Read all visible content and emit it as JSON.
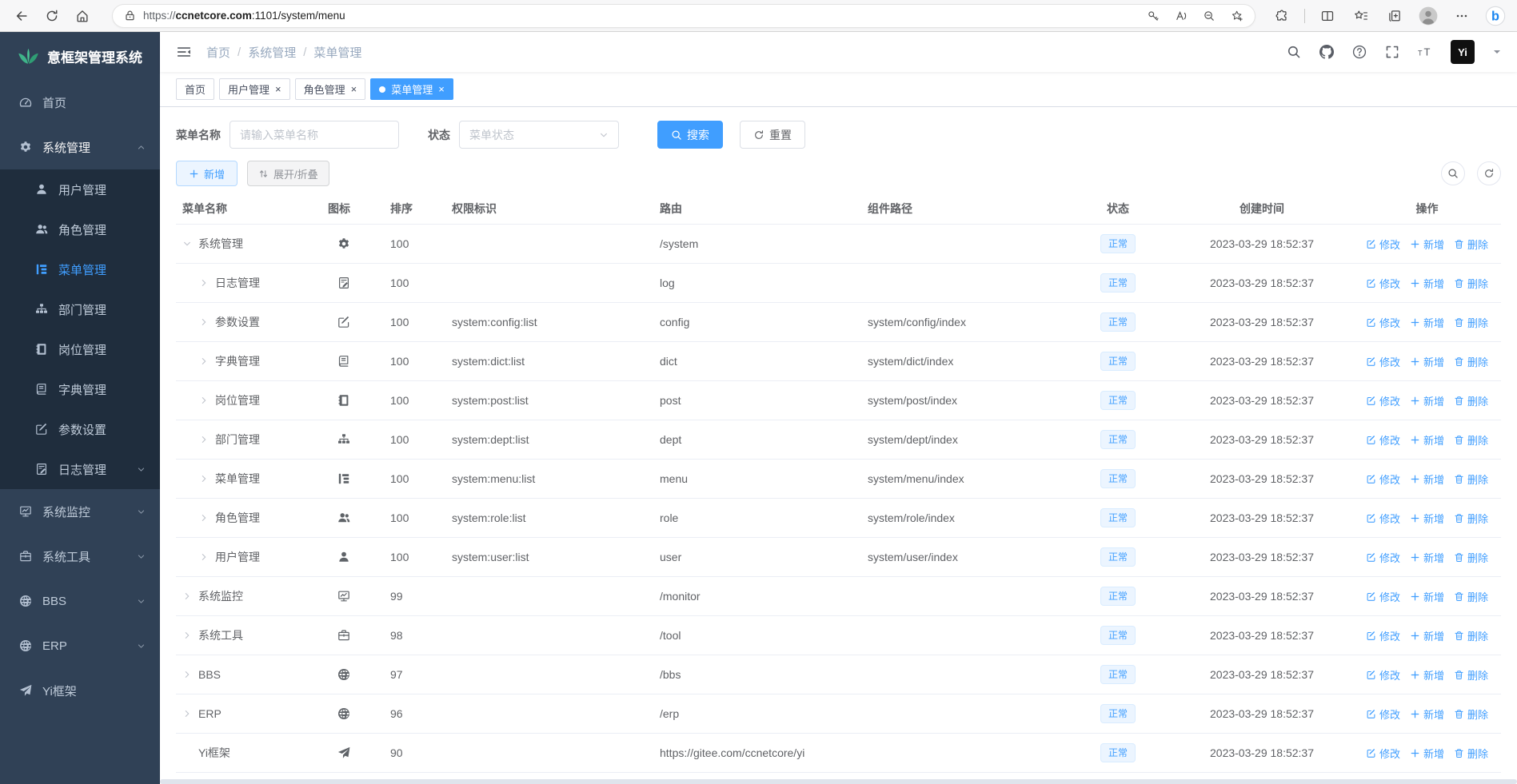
{
  "colors": {
    "accent": "#409eff",
    "sidebar_bg": "#304156",
    "submenu_bg": "#1f2d3d",
    "sidebar_text": "#bfcbd9",
    "logo_green": "#3eb489",
    "badge_bg": "#ecf5ff",
    "badge_text": "#409eff",
    "tab_active_bg": "#409eff"
  },
  "browser": {
    "url_scheme": "https://",
    "url_domain": "ccnetcore.com",
    "url_rest": ":1101/system/menu"
  },
  "sidebar": {
    "logo_text": "意框架管理系统",
    "items": [
      {
        "id": "home",
        "label": "首页",
        "icon": "dashboard-icon",
        "level": "top"
      },
      {
        "id": "system",
        "label": "系统管理",
        "icon": "gear-icon",
        "level": "top",
        "chevron": "up",
        "open": true
      },
      {
        "id": "user",
        "label": "用户管理",
        "icon": "user-icon",
        "level": "sub"
      },
      {
        "id": "role",
        "label": "角色管理",
        "icon": "users-icon",
        "level": "sub"
      },
      {
        "id": "menu",
        "label": "菜单管理",
        "icon": "menu-tree-icon",
        "level": "sub",
        "active": true
      },
      {
        "id": "dept",
        "label": "部门管理",
        "icon": "org-tree-icon",
        "level": "sub"
      },
      {
        "id": "post",
        "label": "岗位管理",
        "icon": "badge-icon",
        "level": "sub"
      },
      {
        "id": "dict",
        "label": "字典管理",
        "icon": "dict-icon",
        "level": "sub"
      },
      {
        "id": "config",
        "label": "参数设置",
        "icon": "edit-icon",
        "level": "sub"
      },
      {
        "id": "log",
        "label": "日志管理",
        "icon": "log-icon",
        "level": "sub",
        "chevron": "down"
      },
      {
        "id": "monitor",
        "label": "系统监控",
        "icon": "monitor-icon",
        "level": "top",
        "chevron": "down"
      },
      {
        "id": "tool",
        "label": "系统工具",
        "icon": "toolbox-icon",
        "level": "top",
        "chevron": "down"
      },
      {
        "id": "bbs",
        "label": "BBS",
        "icon": "globe-icon",
        "level": "top",
        "chevron": "down"
      },
      {
        "id": "erp",
        "label": "ERP",
        "icon": "globe-icon",
        "level": "top",
        "chevron": "down"
      },
      {
        "id": "yi",
        "label": "Yi框架",
        "icon": "send-icon",
        "level": "top"
      }
    ]
  },
  "navbar": {
    "breadcrumb": [
      "首页",
      "系统管理",
      "菜单管理"
    ],
    "avatar_text": "Yi"
  },
  "tabs": [
    {
      "label": "首页"
    },
    {
      "label": "用户管理",
      "closable": true
    },
    {
      "label": "角色管理",
      "closable": true
    },
    {
      "label": "菜单管理",
      "closable": true,
      "active": true
    }
  ],
  "filters": {
    "name_label": "菜单名称",
    "name_placeholder": "请输入菜单名称",
    "status_label": "状态",
    "status_placeholder": "菜单状态",
    "search_label": "搜索",
    "reset_label": "重置"
  },
  "toolbar": {
    "add_label": "新增",
    "expand_label": "展开/折叠"
  },
  "table": {
    "headers": [
      "菜单名称",
      "图标",
      "排序",
      "权限标识",
      "路由",
      "组件路径",
      "状态",
      "创建时间",
      "操作"
    ],
    "actions": {
      "edit": "修改",
      "add": "新增",
      "delete": "删除"
    },
    "rows": [
      {
        "name": "系统管理",
        "level": 0,
        "expand": "expanded",
        "icon": "gear-icon",
        "sort": "100",
        "perms": "",
        "route": "/system",
        "component": "",
        "status": "正常",
        "created": "2023-03-29 18:52:37"
      },
      {
        "name": "日志管理",
        "level": 1,
        "expand": "collapsed",
        "icon": "log-icon",
        "sort": "100",
        "perms": "",
        "route": "log",
        "component": "",
        "status": "正常",
        "created": "2023-03-29 18:52:37"
      },
      {
        "name": "参数设置",
        "level": 1,
        "expand": "collapsed",
        "icon": "edit-icon",
        "sort": "100",
        "perms": "system:config:list",
        "route": "config",
        "component": "system/config/index",
        "status": "正常",
        "created": "2023-03-29 18:52:37"
      },
      {
        "name": "字典管理",
        "level": 1,
        "expand": "collapsed",
        "icon": "dict-icon",
        "sort": "100",
        "perms": "system:dict:list",
        "route": "dict",
        "component": "system/dict/index",
        "status": "正常",
        "created": "2023-03-29 18:52:37"
      },
      {
        "name": "岗位管理",
        "level": 1,
        "expand": "collapsed",
        "icon": "badge-icon",
        "sort": "100",
        "perms": "system:post:list",
        "route": "post",
        "component": "system/post/index",
        "status": "正常",
        "created": "2023-03-29 18:52:37"
      },
      {
        "name": "部门管理",
        "level": 1,
        "expand": "collapsed",
        "icon": "org-tree-icon",
        "sort": "100",
        "perms": "system:dept:list",
        "route": "dept",
        "component": "system/dept/index",
        "status": "正常",
        "created": "2023-03-29 18:52:37"
      },
      {
        "name": "菜单管理",
        "level": 1,
        "expand": "collapsed",
        "icon": "menu-tree-icon",
        "sort": "100",
        "perms": "system:menu:list",
        "route": "menu",
        "component": "system/menu/index",
        "status": "正常",
        "created": "2023-03-29 18:52:37"
      },
      {
        "name": "角色管理",
        "level": 1,
        "expand": "collapsed",
        "icon": "users-icon",
        "sort": "100",
        "perms": "system:role:list",
        "route": "role",
        "component": "system/role/index",
        "status": "正常",
        "created": "2023-03-29 18:52:37"
      },
      {
        "name": "用户管理",
        "level": 1,
        "expand": "collapsed",
        "icon": "user-icon",
        "sort": "100",
        "perms": "system:user:list",
        "route": "user",
        "component": "system/user/index",
        "status": "正常",
        "created": "2023-03-29 18:52:37"
      },
      {
        "name": "系统监控",
        "level": 0,
        "expand": "collapsed",
        "icon": "monitor-icon",
        "sort": "99",
        "perms": "",
        "route": "/monitor",
        "component": "",
        "status": "正常",
        "created": "2023-03-29 18:52:37"
      },
      {
        "name": "系统工具",
        "level": 0,
        "expand": "collapsed",
        "icon": "toolbox-icon",
        "sort": "98",
        "perms": "",
        "route": "/tool",
        "component": "",
        "status": "正常",
        "created": "2023-03-29 18:52:37"
      },
      {
        "name": "BBS",
        "level": 0,
        "expand": "collapsed",
        "icon": "globe-icon",
        "sort": "97",
        "perms": "",
        "route": "/bbs",
        "component": "",
        "status": "正常",
        "created": "2023-03-29 18:52:37"
      },
      {
        "name": "ERP",
        "level": 0,
        "expand": "collapsed",
        "icon": "globe-icon",
        "sort": "96",
        "perms": "",
        "route": "/erp",
        "component": "",
        "status": "正常",
        "created": "2023-03-29 18:52:37"
      },
      {
        "name": "Yi框架",
        "level": 0,
        "expand": "none",
        "icon": "send-icon",
        "sort": "90",
        "perms": "",
        "route": "https://gitee.com/ccnetcore/yi",
        "component": "",
        "status": "正常",
        "created": "2023-03-29 18:52:37"
      }
    ]
  }
}
